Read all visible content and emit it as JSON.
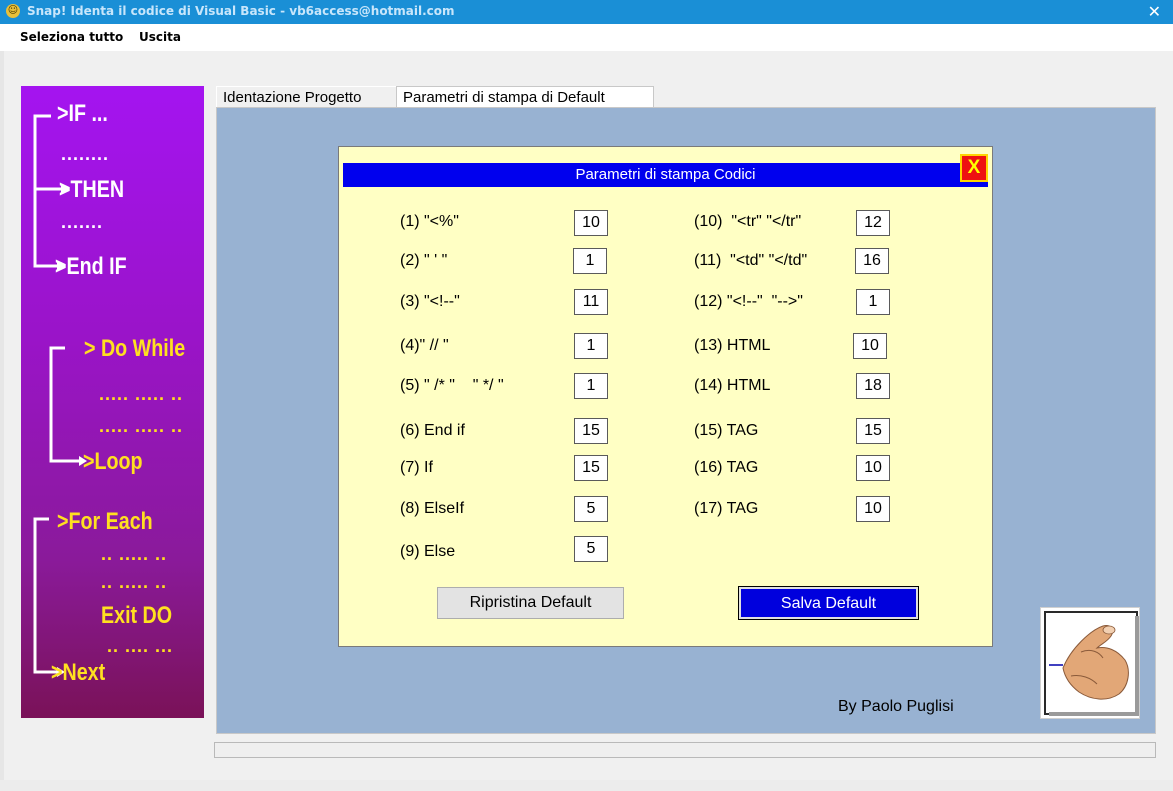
{
  "window": {
    "title": "Snap!  Identa il codice di Visual Basic  - vb6access@hotmail.com",
    "close_glyph": "✕"
  },
  "menu": {
    "select_all": "Seleziona tutto",
    "exit": "Uscita"
  },
  "sidebar": {
    "if": ">IF ...",
    "then": ">THEN",
    "end_if": ">End IF",
    "do_while": "> Do While",
    "loop": ">Loop",
    "for_each": ">For Each",
    "exit_do": "Exit DO",
    "next": ">Next",
    "dots1": "........",
    "dots2": ".......",
    "dots3": "..... ..... ..",
    "dots4": "..... ..... ..",
    "dots5": "..  .....  ..",
    "dots6": "..  .....  ..",
    "dots7": "..  ....   ...",
    "gradient": [
      "#a414f0",
      "#7a1258"
    ],
    "text_color": "#ffffff",
    "accent_color": "#ffe020"
  },
  "tabs": [
    {
      "label": "Identazione Progetto",
      "active": false
    },
    {
      "label": "Parametri di stampa di Default",
      "active": true
    }
  ],
  "dialog": {
    "title": "Parametri di stampa Codici",
    "close_label": "X",
    "params_left": [
      {
        "label": "(1) \"<%\"",
        "value": "10"
      },
      {
        "label": "(2) \" ' \"",
        "value": "1"
      },
      {
        "label": "(3) \"<!--\"",
        "value": "11"
      },
      {
        "label": "(4)\" // \"",
        "value": "1"
      },
      {
        "label": "(5) \" /* \"    \" */ \"",
        "value": "1"
      },
      {
        "label": "(6) End if",
        "value": "15"
      },
      {
        "label": "(7) If",
        "value": "15"
      },
      {
        "label": "(8) ElseIf",
        "value": "5"
      },
      {
        "label": "(9) Else",
        "value": "5"
      }
    ],
    "params_right": [
      {
        "label": "(10)  \"<tr\" \"</tr\"",
        "value": "12"
      },
      {
        "label": "(11)  \"<td\" \"</td\"",
        "value": "16"
      },
      {
        "label": "(12) \"<!--\"  \"-->\"",
        "value": "1"
      },
      {
        "label": "(13) HTML",
        "value": "10"
      },
      {
        "label": "(14) HTML",
        "value": "18"
      },
      {
        "label": "(15) TAG",
        "value": "15"
      },
      {
        "label": "(16) TAG",
        "value": "10"
      },
      {
        "label": "(17) TAG",
        "value": "10"
      }
    ],
    "restore_button": "Ripristina Default",
    "save_button": "Salva Default",
    "header_color": "#0000ee",
    "background_color": "#ffffc4"
  },
  "author": "By Paolo Puglisi",
  "colors": {
    "titlebar": "#1a8fd6",
    "panel": "#98b2d2"
  }
}
